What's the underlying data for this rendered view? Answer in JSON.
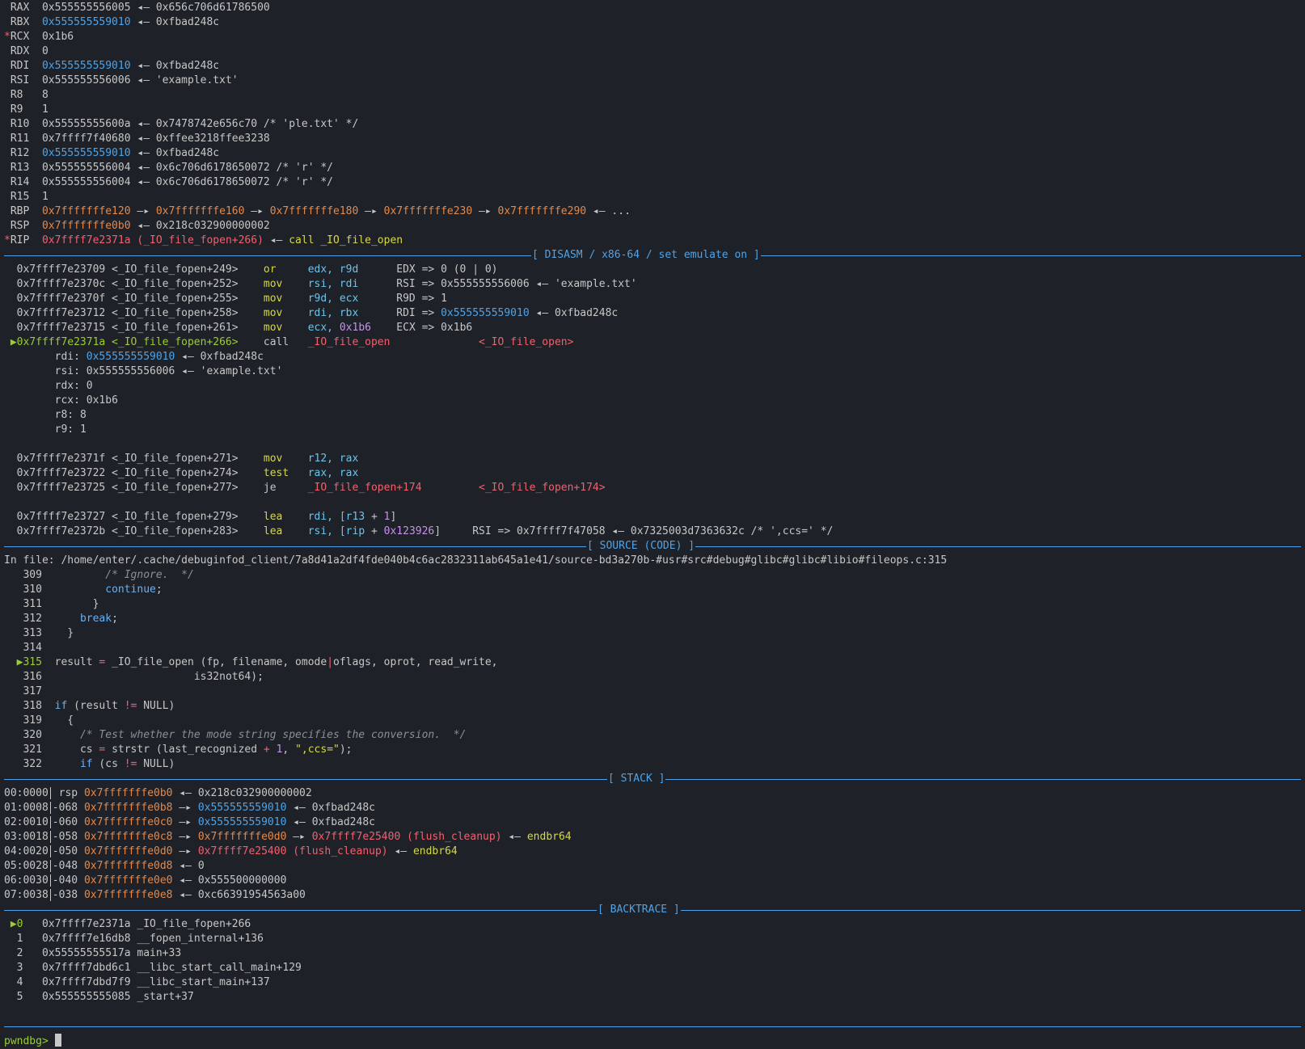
{
  "registers": [
    {
      "star": "",
      "name": "RAX",
      "value": "0x555555556005",
      "value_color": "dim",
      "tail": " ◂— 0x656c706d61786500"
    },
    {
      "star": "",
      "name": "RBX",
      "value": "0x555555559010",
      "value_color": "blue",
      "tail": " ◂— 0xfbad248c"
    },
    {
      "star": "*",
      "name": "RCX",
      "value": "0x1b6",
      "value_color": "dim",
      "tail": ""
    },
    {
      "star": "",
      "name": "RDX",
      "value": "0",
      "value_color": "dim",
      "tail": ""
    },
    {
      "star": "",
      "name": "RDI",
      "value": "0x555555559010",
      "value_color": "blue",
      "tail": " ◂— 0xfbad248c"
    },
    {
      "star": "",
      "name": "RSI",
      "value": "0x555555556006",
      "value_color": "dim",
      "tail": " ◂— 'example.txt'"
    },
    {
      "star": "",
      "name": "R8",
      "value": "8",
      "value_color": "dim",
      "tail": ""
    },
    {
      "star": "",
      "name": "R9",
      "value": "1",
      "value_color": "dim",
      "tail": ""
    },
    {
      "star": "",
      "name": "R10",
      "value": "0x55555555600a",
      "value_color": "dim",
      "tail": " ◂— 0x7478742e656c70 /* 'ple.txt' */"
    },
    {
      "star": "",
      "name": "R11",
      "value": "0x7ffff7f40680",
      "value_color": "dim",
      "tail": " ◂— 0xffee3218ffee3238"
    },
    {
      "star": "",
      "name": "R12",
      "value": "0x555555559010",
      "value_color": "blue",
      "tail": " ◂— 0xfbad248c"
    },
    {
      "star": "",
      "name": "R13",
      "value": "0x555555556004",
      "value_color": "dim",
      "tail": " ◂— 0x6c706d6178650072 /* 'r' */"
    },
    {
      "star": "",
      "name": "R14",
      "value": "0x555555556004",
      "value_color": "dim",
      "tail": " ◂— 0x6c706d6178650072 /* 'r' */"
    },
    {
      "star": "",
      "name": "R15",
      "value": "1",
      "value_color": "dim",
      "tail": ""
    }
  ],
  "rbp": {
    "name": "RBP",
    "chain": [
      "0x7fffffffe120",
      "0x7fffffffe160",
      "0x7fffffffe180",
      "0x7fffffffe230",
      "0x7fffffffe290"
    ],
    "arrow": " —▸ ",
    "end": " ◂— ..."
  },
  "rsp": {
    "name": "RSP",
    "value": "0x7fffffffe0b0",
    "tail": " ◂— 0x218c032900000002"
  },
  "rip": {
    "star": "*",
    "name": "RIP",
    "value": "0x7ffff7e2371a (_IO_file_fopen+266)",
    "arrow": " ◂— ",
    "insn": "call _IO_file_open"
  },
  "sections": {
    "disasm": "[ DISASM / x86-64 / set emulate on ]",
    "source": "[ SOURCE (CODE) ]",
    "stack": "[ STACK ]",
    "backtrace": "[ BACKTRACE ]"
  },
  "disasm": [
    {
      "marker": "",
      "addr": "0x7ffff7e23709 <_IO_file_fopen+249>",
      "mnem": "or",
      "ops": "edx, r9d",
      "comment": "EDX => 0 (0 | 0)"
    },
    {
      "marker": "",
      "addr": "0x7ffff7e2370c <_IO_file_fopen+252>",
      "mnem": "mov",
      "ops": "rsi, rdi",
      "comment": "RSI => 0x555555556006 ◂— 'example.txt'"
    },
    {
      "marker": "",
      "addr": "0x7ffff7e2370f <_IO_file_fopen+255>",
      "mnem": "mov",
      "ops": "r9d, ecx",
      "comment": "R9D => 1"
    },
    {
      "marker": "",
      "addr": "0x7ffff7e23712 <_IO_file_fopen+258>",
      "mnem": "mov",
      "ops": "rdi, rbx",
      "comment_pre": "RDI => ",
      "comment_hl": "0x555555559010",
      "comment_post": " ◂— 0xfbad248c"
    },
    {
      "marker": "",
      "addr": "0x7ffff7e23715 <_IO_file_fopen+261>",
      "mnem": "mov",
      "ops_a": "ecx, ",
      "ops_num": "0x1b6",
      "comment": "ECX => 0x1b6"
    },
    {
      "marker": "▶",
      "addr": "0x7ffff7e2371a <_IO_file_fopen+266>",
      "mnem": "call",
      "target": "_IO_file_open",
      "target2": "<_IO_file_open>"
    }
  ],
  "call_args": [
    {
      "name": "rdi:",
      "value": "0x555555559010",
      "value_color": "blue",
      "tail": " ◂— 0xfbad248c"
    },
    {
      "name": "rsi:",
      "value": "0x555555556006",
      "value_color": "dim",
      "tail": " ◂— 'example.txt'"
    },
    {
      "name": "rdx:",
      "value": "0",
      "value_color": "dim",
      "tail": ""
    },
    {
      "name": "rcx:",
      "value": "0x1b6",
      "value_color": "dim",
      "tail": ""
    },
    {
      "name": "r8:",
      "value": "8",
      "value_color": "dim",
      "tail": ""
    },
    {
      "name": "r9:",
      "value": "1",
      "value_color": "dim",
      "tail": ""
    }
  ],
  "disasm2": [
    {
      "addr": "0x7ffff7e2371f <_IO_file_fopen+271>",
      "mnem": "mov",
      "ops": "r12, rax"
    },
    {
      "addr": "0x7ffff7e23722 <_IO_file_fopen+274>",
      "mnem": "test",
      "ops": "rax, rax"
    },
    {
      "addr": "0x7ffff7e23725 <_IO_file_fopen+277>",
      "mnem": "je",
      "target": "_IO_file_fopen+174",
      "target2": "<_IO_file_fopen+174>"
    }
  ],
  "disasm3": [
    {
      "addr": "0x7ffff7e23727 <_IO_file_fopen+279>",
      "mnem": "lea",
      "ops_a": "rdi, [",
      "reg": "r13",
      "mid": " + ",
      "num": "1",
      "close": "]",
      "comment": ""
    },
    {
      "addr": "0x7ffff7e2372b <_IO_file_fopen+283>",
      "mnem": "lea",
      "ops_a": "rsi, [",
      "reg": "rip",
      "mid": " + ",
      "num": "0x123926",
      "close": "]",
      "comment": "RSI => 0x7ffff7f47058 ◂— 0x7325003d7363632c /* ',ccs=' */"
    }
  ],
  "source_file": "In file: /home/enter/.cache/debuginfod_client/7a8d41a2df4fde040b4c6ac2832311ab645a1e41/source-bd3a270b-#usr#src#debug#glibc#glibc#libio#fileops.c:315",
  "source_lines": {
    "l309": "309",
    "l310": "310",
    "l311": "311",
    "l312": "312",
    "l313": "313",
    "l314": "314",
    "l315": "315",
    "l316": "316",
    "l317": "317",
    "l318": "318",
    "l319": "319",
    "l320": "320",
    "l321": "321",
    "l322": "322",
    "c309": "/* Ignore.  */",
    "c310": "continue",
    "c312": "break",
    "c315a": "result ",
    "c315b": "=",
    "c315c": " _IO_file_open (fp, filename, omode",
    "c315d": "|",
    "c315e": "oflags, oprot, read_write,",
    "c316": "is32not64);",
    "c318a": "if",
    "c318b": " (result ",
    "c318c": "!=",
    "c318d": " NULL)",
    "c320": "/* Test whether the mode string specifies the conversion.  */",
    "c321a": "cs ",
    "c321b": "=",
    "c321c": " strstr (last_recognized ",
    "c321d": "+",
    "c321e": " ",
    "c321f": "1",
    "c321g": ", ",
    "c321h": "\",ccs=\"",
    "c321i": ");",
    "c322a": "if",
    "c322b": " (cs ",
    "c322c": "!=",
    "c322d": " NULL)"
  },
  "stack": [
    {
      "idx": "00:0000",
      "off": " rsp ",
      "addr": "0x7fffffffe0b0",
      "rest_pre": " ◂— 0x218c032900000002",
      "links": []
    },
    {
      "idx": "01:0008",
      "off": "-068 ",
      "addr": "0x7fffffffe0b8",
      "rest_pre": " —▸ ",
      "link_blue": "0x555555559010",
      "rest": " ◂— 0xfbad248c"
    },
    {
      "idx": "02:0010",
      "off": "-060 ",
      "addr": "0x7fffffffe0c0",
      "rest_pre": " —▸ ",
      "link_blue": "0x555555559010",
      "rest": " ◂— 0xfbad248c"
    },
    {
      "idx": "03:0018",
      "off": "-058 ",
      "addr": "0x7fffffffe0c8",
      "rest_pre": " —▸ ",
      "link_orange": "0x7fffffffe0d0",
      "mid": " —▸ ",
      "link_red": "0x7ffff7e25400 (flush_cleanup)",
      "arrow2": " ◂— ",
      "insn": "endbr64"
    },
    {
      "idx": "04:0020",
      "off": "-050 ",
      "addr": "0x7fffffffe0d0",
      "rest_pre": " —▸ ",
      "link_red": "0x7ffff7e25400 (flush_cleanup)",
      "arrow2": " ◂— ",
      "insn": "endbr64"
    },
    {
      "idx": "05:0028",
      "off": "-048 ",
      "addr": "0x7fffffffe0d8",
      "rest_pre": " ◂— 0"
    },
    {
      "idx": "06:0030",
      "off": "-040 ",
      "addr": "0x7fffffffe0e0",
      "rest_pre": " ◂— 0x555500000000"
    },
    {
      "idx": "07:0038",
      "off": "-038 ",
      "addr": "0x7fffffffe0e8",
      "rest_pre": " ◂— 0xc66391954563a00"
    }
  ],
  "backtrace": [
    {
      "marker": "▶",
      "num": "0",
      "addr": "0x7ffff7e2371a",
      "sym": "_IO_file_fopen+266"
    },
    {
      "marker": "",
      "num": "1",
      "addr": "0x7ffff7e16db8",
      "sym": "__fopen_internal+136"
    },
    {
      "marker": "",
      "num": "2",
      "addr": "0x55555555517a",
      "sym": "main+33"
    },
    {
      "marker": "",
      "num": "3",
      "addr": "0x7ffff7dbd6c1",
      "sym": "__libc_start_call_main+129"
    },
    {
      "marker": "",
      "num": "4",
      "addr": "0x7ffff7dbd7f9",
      "sym": "__libc_start_main+137"
    },
    {
      "marker": "",
      "num": "5",
      "addr": "0x555555555085",
      "sym": "_start+37"
    }
  ],
  "prompt": "pwndbg>"
}
